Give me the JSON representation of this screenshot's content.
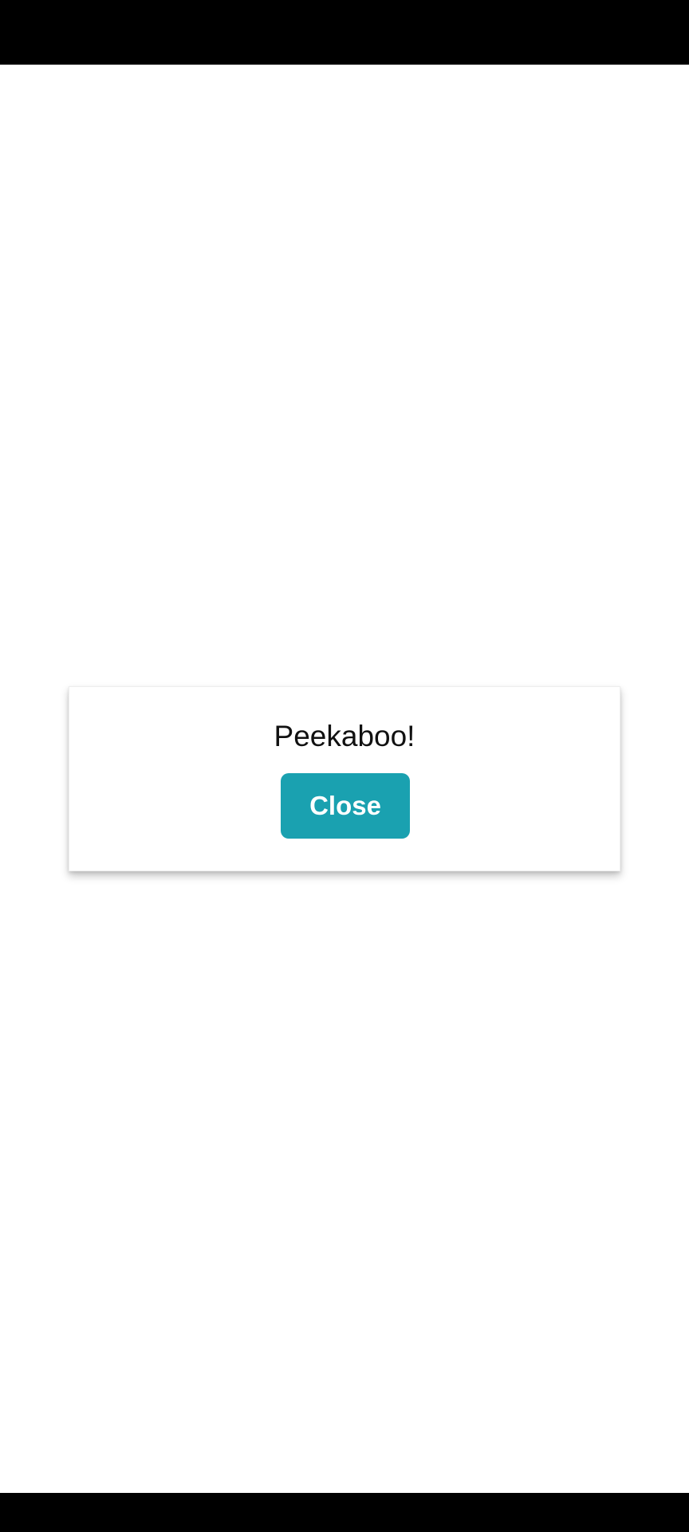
{
  "dialog": {
    "message": "Peekaboo!",
    "close_label": "Close"
  },
  "colors": {
    "accent": "#1aa1b0",
    "system_bars": "#000000",
    "background": "#ffffff"
  }
}
